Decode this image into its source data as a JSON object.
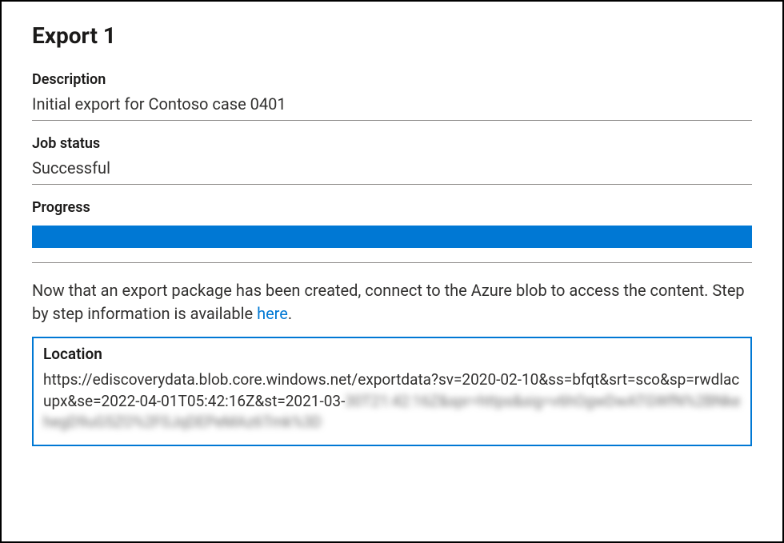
{
  "page_title": "Export 1",
  "description": {
    "label": "Description",
    "value": "Initial export for Contoso case 0401"
  },
  "job_status": {
    "label": "Job status",
    "value": "Successful"
  },
  "progress": {
    "label": "Progress",
    "percent": 100,
    "bar_color": "#0078d4"
  },
  "info": {
    "text_before": "Now that an export package has been created, connect to the Azure blob to access the content. Step by step information is available ",
    "link_text": "here",
    "text_after": "."
  },
  "location": {
    "label": "Location",
    "url_visible": "https://ediscoverydata.blob.core.windows.net/exportdata?sv=2020-02-10&ss=bfqt&srt=sco&sp=rwdlacupx&se=2022-04-01T05:42:16Z&st=2021-03-",
    "url_redacted": "30T21:42:16Z&spr=https&sig=v6hOgwDwATGWfN%2BNkehegD9uG5ZO%2F0JqDEPeMAz6Tmk%3D"
  }
}
